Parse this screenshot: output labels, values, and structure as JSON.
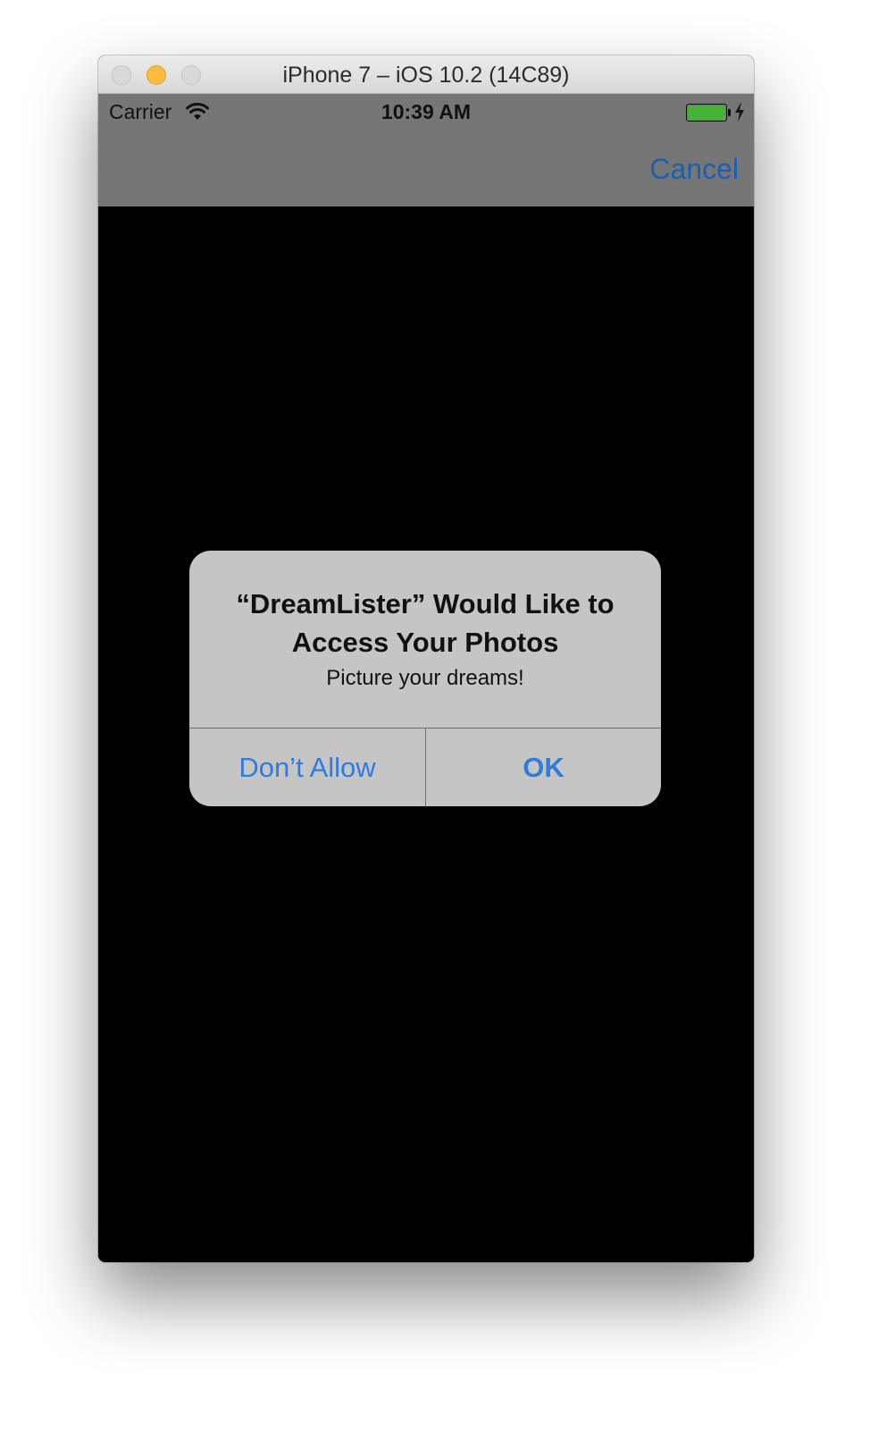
{
  "window": {
    "title": "iPhone 7 – iOS 10.2 (14C89)"
  },
  "status_bar": {
    "carrier": "Carrier",
    "time": "10:39 AM",
    "battery_level": 1.0,
    "charging": true
  },
  "nav_bar": {
    "cancel_label": "Cancel"
  },
  "alert": {
    "title": "“DreamLister” Would Like to Access Your Photos",
    "message": "Picture your dreams!",
    "buttons": [
      {
        "label": "Don’t Allow"
      },
      {
        "label": "OK"
      }
    ]
  },
  "colors": {
    "accent": "#2f7be0",
    "nav_cancel": "#1a5fb1",
    "bar_background": "#767676",
    "alert_background": "#c5c5c5",
    "battery": "#46b238"
  },
  "icons": [
    "wifi-icon",
    "battery-icon",
    "charging-bolt-icon"
  ]
}
